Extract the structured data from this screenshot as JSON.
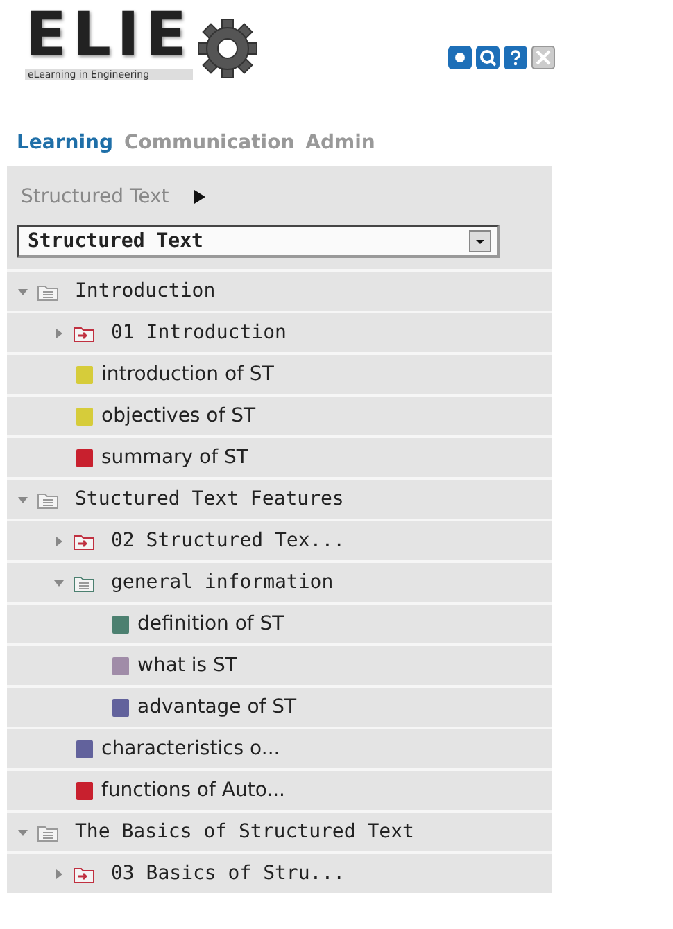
{
  "logo": {
    "title": "ELIE",
    "subtitle": "eLearning in Engineering"
  },
  "tabs": [
    {
      "label": "Learning",
      "selected": true
    },
    {
      "label": "Communication",
      "selected": false
    },
    {
      "label": "Admin",
      "selected": false
    }
  ],
  "breadcrumb": "Structured Text",
  "course_select": {
    "value": "Structured Text"
  },
  "tree": [
    {
      "kind": "folder",
      "label": "Introduction",
      "expanded": true,
      "children": [
        {
          "kind": "module",
          "label": "01 Introduction",
          "expanded": false
        },
        {
          "kind": "page",
          "label": "introduction of ST",
          "color": "#d6cc3a"
        },
        {
          "kind": "page",
          "label": "objectives of ST",
          "color": "#d6cc3a"
        },
        {
          "kind": "page",
          "label": "summary of ST",
          "color": "#c8202e"
        }
      ]
    },
    {
      "kind": "folder",
      "label": "Stuctured Text Features",
      "expanded": true,
      "children": [
        {
          "kind": "module",
          "label": "02 Structured Tex...",
          "expanded": false
        },
        {
          "kind": "folder",
          "label": "general information",
          "expanded": true,
          "children": [
            {
              "kind": "page",
              "label": "definition of ST",
              "color": "#4c8070"
            },
            {
              "kind": "page",
              "label": "what is ST",
              "color": "#a08ca8"
            },
            {
              "kind": "page",
              "label": "advantage of ST",
              "color": "#62629c"
            }
          ]
        },
        {
          "kind": "page",
          "label": "characteristics o...",
          "color": "#62629c"
        },
        {
          "kind": "page",
          "label": "functions of Auto...",
          "color": "#c8202e"
        }
      ]
    },
    {
      "kind": "folder",
      "label": "The Basics of Structured Text",
      "expanded": true,
      "children": [
        {
          "kind": "module",
          "label": "03 Basics of Stru...",
          "expanded": false
        }
      ]
    }
  ]
}
